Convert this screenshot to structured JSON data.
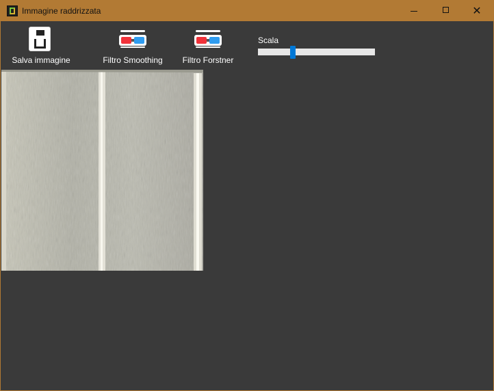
{
  "window": {
    "title": "Immagine raddrizzata",
    "title_bar_color": "#b27a34",
    "background_color": "#3a3a3a"
  },
  "toolbar": {
    "save": {
      "label": "Salva immagine",
      "icon": "floppy-disk-icon"
    },
    "smoothing": {
      "label": "Filtro Smoothing",
      "icon": "3d-glasses-icon"
    },
    "forstner": {
      "label": "Filtro Forstner",
      "icon": "3d-glasses-icon"
    }
  },
  "scale": {
    "label": "Scala",
    "value_fraction": 0.29,
    "accent_color": "#0078d7"
  },
  "image": {
    "description_icon": "concrete-texture-image"
  }
}
